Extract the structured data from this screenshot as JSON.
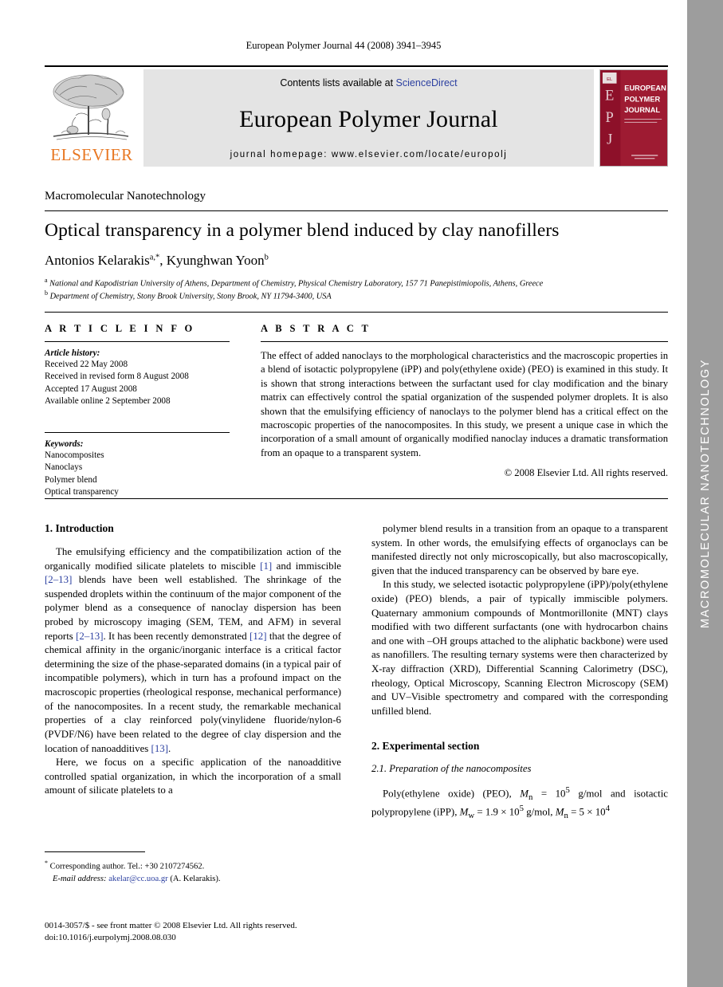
{
  "side_band": {
    "label": "MACROMOLECULAR NANOTECHNOLOGY",
    "background_color": "#9d9d9d",
    "text_color": "#ffffff"
  },
  "running_head": "European Polymer Journal 44 (2008) 3941–3945",
  "masthead": {
    "publisher_name": "ELSEVIER",
    "publisher_color": "#E87722",
    "contents_prefix": "Contents lists available at ",
    "sciencedirect": "ScienceDirect",
    "sciencedirect_color": "#2b3fa0",
    "journal_title": "European Polymer Journal",
    "homepage": "journal homepage: www.elsevier.com/locate/europolj",
    "cover": {
      "line1": "EUROPEAN",
      "line2": "POLYMER",
      "line3": "JOURNAL",
      "spine_letters": [
        "E",
        "P",
        "J"
      ],
      "color": "#9e1b32"
    }
  },
  "article": {
    "section_label": "Macromolecular Nanotechnology",
    "title": "Optical transparency in a polymer blend induced by clay nanofillers",
    "authors": [
      {
        "name": "Antonios Kelarakis",
        "marks": "a,*"
      },
      {
        "name": "Kyunghwan Yoon",
        "marks": "b"
      }
    ],
    "authors_text": "Antonios Kelarakis",
    "affiliations": [
      {
        "mark": "a",
        "text": "National and Kapodistrian University of Athens, Department of Chemistry, Physical Chemistry Laboratory, 157 71 Panepistimiopolis, Athens, Greece"
      },
      {
        "mark": "b",
        "text": "Department of Chemistry, Stony Brook University, Stony Brook, NY 11794-3400, USA"
      }
    ]
  },
  "article_info": {
    "heading": "A R T I C L E   I N F O",
    "history_heading": "Article history:",
    "history": [
      "Received 22 May 2008",
      "Received in revised form 8 August 2008",
      "Accepted 17 August 2008",
      "Available online 2 September 2008"
    ],
    "keywords_heading": "Keywords:",
    "keywords": [
      "Nanocomposites",
      "Nanoclays",
      "Polymer blend",
      "Optical transparency"
    ]
  },
  "abstract": {
    "heading": "A B S T R A C T",
    "text": "The effect of added nanoclays to the morphological characteristics and the macroscopic properties in a blend of isotactic polypropylene (iPP) and poly(ethylene oxide) (PEO) is examined in this study. It is shown that strong interactions between the surfactant used for clay modification and the binary matrix can effectively control the spatial organization of the suspended polymer droplets. It is also shown that the emulsifying efficiency of nanoclays to the polymer blend has a critical effect on the macroscopic properties of the nanocomposites. In this study, we present a unique case in which the incorporation of a small amount of organically modified nanoclay induces a dramatic transformation from an opaque to a transparent system.",
    "copyright": "© 2008 Elsevier Ltd. All rights reserved."
  },
  "body": {
    "intro_heading": "1. Introduction",
    "intro_p1_a": "The emulsifying efficiency and the compatibilization action of the organically modified silicate platelets to miscible ",
    "intro_p1_ref1": "[1]",
    "intro_p1_b": " and immiscible ",
    "intro_p1_ref2": "[2–13]",
    "intro_p1_c": " blends have been well established. The shrinkage of the suspended droplets within the continuum of the major component of the polymer blend as a consequence of nanoclay dispersion has been probed by microscopy imaging (SEM, TEM, and AFM) in several reports ",
    "intro_p1_ref3": "[2–13]",
    "intro_p1_d": ". It has been recently demonstrated ",
    "intro_p1_ref4": "[12]",
    "intro_p1_e": " that the degree of chemical affinity in the organic/inorganic interface is a critical factor determining the size of the phase-separated domains (in a typical pair of incompatible polymers), which in turn has a profound impact on the macroscopic properties (rheological response, mechanical performance) of the nanocomposites. In a recent study, the remarkable mechanical properties of a clay reinforced poly(vinylidene fluoride/nylon-6 (PVDF/N6) have been related to the degree of clay dispersion and the location of nanoadditives ",
    "intro_p1_ref5": "[13]",
    "intro_p1_f": ".",
    "intro_p2": "Here, we focus on a specific application of the nanoadditive controlled spatial organization, in which the incorporation of a small amount of silicate platelets to a",
    "right_p1": "polymer blend results in a transition from an opaque to a transparent system. In other words, the emulsifying effects of organoclays can be manifested directly not only microscopically, but also macroscopically, given that the induced transparency can be observed by bare eye.",
    "right_p2": "In this study, we selected isotactic polypropylene (iPP)/poly(ethylene oxide) (PEO) blends, a pair of typically immiscible polymers. Quaternary ammonium compounds of Montmorillonite (MNT) clays modified with two different surfactants (one with hydrocarbon chains and one with –OH groups attached to the aliphatic backbone) were used as nanofillers. The resulting ternary systems were then characterized by X-ray diffraction (XRD), Differential Scanning Calorimetry (DSC), rheology, Optical Microscopy, Scanning Electron Microscopy (SEM) and UV–Visible spectrometry and compared with the corresponding unfilled blend.",
    "exp_heading": "2. Experimental section",
    "exp_sub_heading": "2.1. Preparation of the nanocomposites",
    "exp_p1_pre": "Poly(ethylene oxide) (PEO), ",
    "exp_p1_mn1": "M",
    "exp_p1_mn1_sub": "n",
    "exp_p1_mid1": " = 10",
    "exp_p1_sup1": "5",
    "exp_p1_mid2": " g/mol and isotactic polypropylene  (iPP),   ",
    "exp_p1_mw": "M",
    "exp_p1_mw_sub": "w",
    "exp_p1_mid3": " = 1.9 × 10",
    "exp_p1_sup2": "5",
    "exp_p1_mid4": " g/mol,   ",
    "exp_p1_mn2": "M",
    "exp_p1_mn2_sub": "n",
    "exp_p1_mid5": " = 5 × 10",
    "exp_p1_sup3": "4"
  },
  "footnote": {
    "corresponding_marker": "*",
    "corresponding": " Corresponding author. Tel.: +30 2107274562.",
    "email_label": "E-mail address:",
    "email": "akelar@cc.uoa.gr",
    "email_color": "#2b3fa0",
    "email_suffix": " (A. Kelarakis).",
    "issn_line": "0014-3057/$ - see front matter © 2008 Elsevier Ltd. All rights reserved.",
    "doi_line": "doi:10.1016/j.eurpolymj.2008.08.030"
  }
}
